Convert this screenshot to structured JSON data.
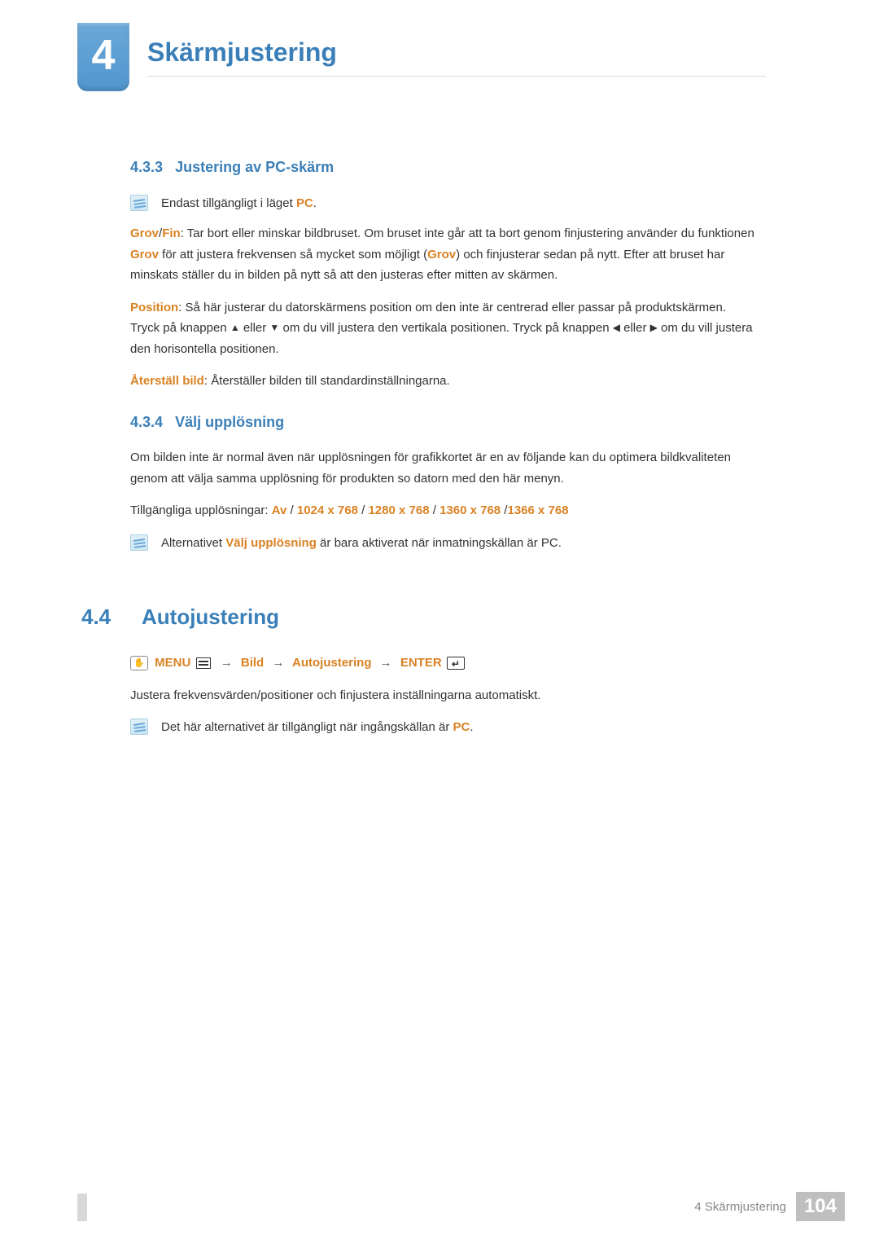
{
  "chapter": {
    "number": "4",
    "title": "Skärmjustering"
  },
  "section_433": {
    "num": "4.3.3",
    "title": "Justering av PC-skärm",
    "note_prefix": "Endast tillgängligt i läget ",
    "note_hl": "PC",
    "note_suffix": ".",
    "p1_hl1": "Grov",
    "p1_sep": "/",
    "p1_hl2": "Fin",
    "p1_t1": ": Tar bort eller minskar bildbruset. Om bruset inte går att ta bort genom finjustering använder du funktionen ",
    "p1_hl3": "Grov",
    "p1_t2": " för att justera frekvensen så mycket som möjligt (",
    "p1_hl4": "Grov",
    "p1_t3": ") och finjusterar sedan på nytt. Efter att bruset har minskats ställer du in bilden på nytt så att den justeras efter mitten av skärmen.",
    "p2_hl": "Position",
    "p2_t1": ": Så här justerar du datorskärmens position om den inte är centrerad eller passar på produktskärmen. Tryck på knappen ",
    "p2_t2": " eller ",
    "p2_t3": " om du vill justera den vertikala positionen. Tryck på knappen ",
    "p2_t4": " eller ",
    "p2_t5": " om du vill justera den horisontella positionen.",
    "p3_hl": "Återställ bild",
    "p3_t": ": Återställer bilden till standardinställningarna."
  },
  "section_434": {
    "num": "4.3.4",
    "title": "Välj upplösning",
    "p1": "Om bilden inte är normal även när upplösningen för grafikkortet är en av följande kan du optimera bildkvaliteten genom att välja samma upplösning för produkten so datorn med den här menyn.",
    "p2_prefix": "Tillgängliga upplösningar: ",
    "res": [
      "Av",
      "1024 x 768",
      "1280 x 768",
      "1360 x 768",
      "1366 x 768"
    ],
    "sep": " / ",
    "note_prefix": "Alternativet ",
    "note_hl": "Välj upplösning",
    "note_suffix": " är bara aktiverat när inmatningskällan är PC."
  },
  "section_44": {
    "num": "4.4",
    "title": "Autojustering",
    "path": {
      "menu": "MENU",
      "bild": "Bild",
      "auto": "Autojustering",
      "enter": "ENTER"
    },
    "desc": "Justera frekvensvärden/positioner och finjustera inställningarna automatiskt.",
    "note_prefix": "Det här alternativet är tillgängligt när ingångskällan är ",
    "note_hl": "PC",
    "note_suffix": "."
  },
  "footer": {
    "label": "4 Skärmjustering",
    "page": "104"
  }
}
